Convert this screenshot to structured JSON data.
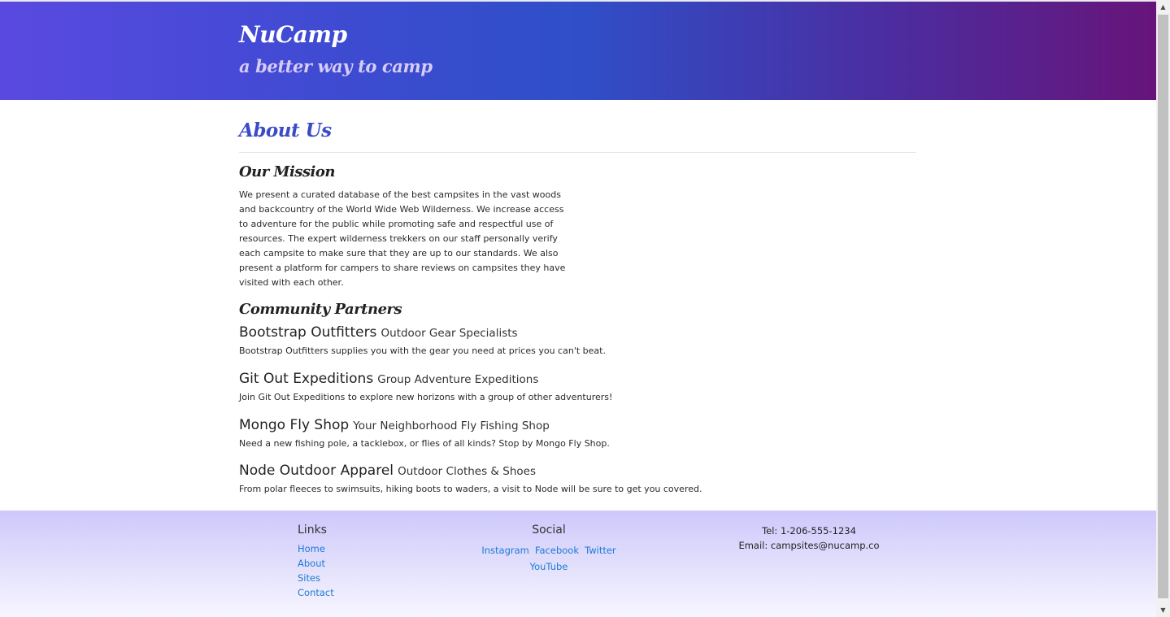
{
  "header": {
    "brand": "NuCamp",
    "tagline": "a better way to camp"
  },
  "main": {
    "title": "About Us",
    "mission": {
      "heading": "Our Mission",
      "text": "We present a curated database of the best campsites in the vast woods and backcountry of the World Wide Web Wilderness. We increase access to adventure for the public while promoting safe and respectful use of resources. The expert wilderness trekkers on our staff personally verify each campsite to make sure that they are up to our standards. We also present a platform for campers to share reviews on campsites they have visited with each other."
    },
    "partners": {
      "heading": "Community Partners",
      "items": [
        {
          "name": "Bootstrap Outfitters",
          "tagline": "Outdoor Gear Specialists",
          "description": "Bootstrap Outfitters supplies you with the gear you need at prices you can't beat."
        },
        {
          "name": "Git Out Expeditions",
          "tagline": "Group Adventure Expeditions",
          "description": "Join Git Out Expeditions to explore new horizons with a group of other adventurers!"
        },
        {
          "name": "Mongo Fly Shop",
          "tagline": "Your Neighborhood Fly Fishing Shop",
          "description": "Need a new fishing pole, a tacklebox, or flies of all kinds? Stop by Mongo Fly Shop."
        },
        {
          "name": "Node Outdoor Apparel",
          "tagline": "Outdoor Clothes & Shoes",
          "description": "From polar fleeces to swimsuits, hiking boots to waders, a visit to Node will be sure to get you covered."
        }
      ]
    }
  },
  "footer": {
    "links_heading": "Links",
    "links": [
      "Home",
      "About",
      "Sites",
      "Contact"
    ],
    "social_heading": "Social",
    "social": [
      "Instagram",
      "Facebook",
      "Twitter",
      "YouTube"
    ],
    "phone": "Tel: 1-206-555-1234",
    "email": "Email: campsites@nucamp.co"
  },
  "colors": {
    "accent": "#3b4bc8",
    "link": "#1c7ad6"
  }
}
